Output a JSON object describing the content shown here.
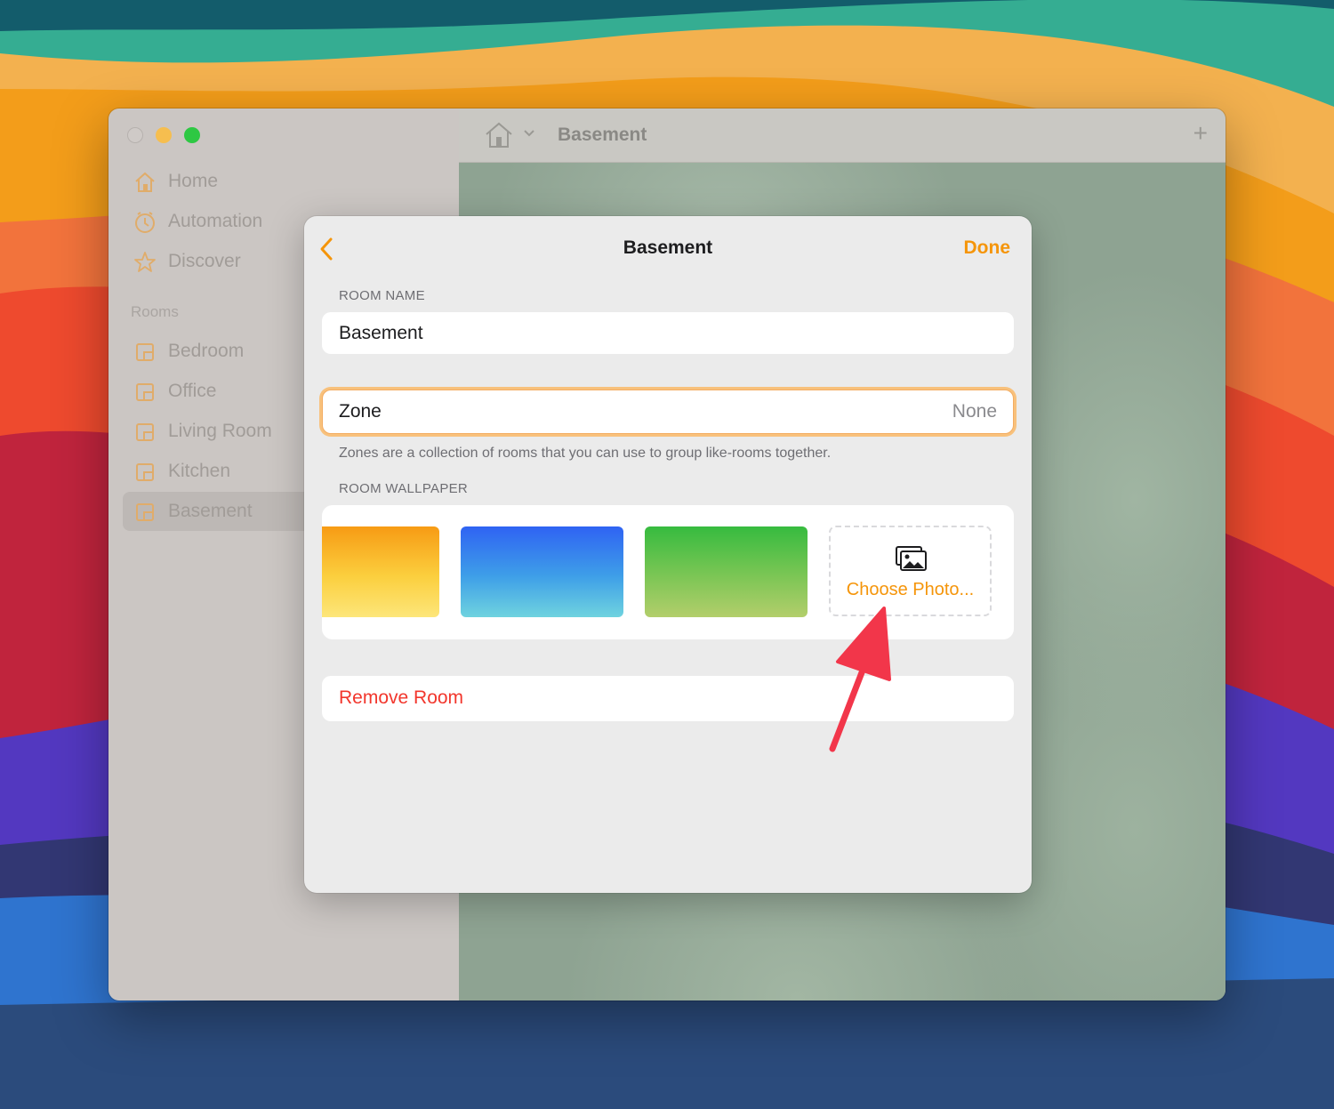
{
  "window": {
    "toolbar_title": "Basement"
  },
  "sidebar": {
    "nav": [
      {
        "label": "Home",
        "icon": "house-icon"
      },
      {
        "label": "Automation",
        "icon": "clock-icon"
      },
      {
        "label": "Discover",
        "icon": "star-icon"
      }
    ],
    "rooms_header": "Rooms",
    "rooms": [
      {
        "label": "Bedroom",
        "icon": "room-icon"
      },
      {
        "label": "Office",
        "icon": "room-icon"
      },
      {
        "label": "Living Room",
        "icon": "room-icon"
      },
      {
        "label": "Kitchen",
        "icon": "room-icon"
      },
      {
        "label": "Basement",
        "icon": "room-icon",
        "selected": true
      }
    ]
  },
  "sheet": {
    "title": "Basement",
    "done_label": "Done",
    "room_name_label": "ROOM NAME",
    "room_name_value": "Basement",
    "zone_label": "Zone",
    "zone_value": "None",
    "zone_helper": "Zones are a collection of rooms that you can use to group like-rooms together.",
    "wallpaper_label": "ROOM WALLPAPER",
    "wallpapers": [
      "orange-yellow-gradient",
      "blue-cyan-gradient",
      "green-lime-gradient"
    ],
    "choose_photo_label": "Choose Photo...",
    "remove_label": "Remove Room"
  },
  "colors": {
    "accent": "#f5950a",
    "destructive": "#f2362c",
    "annotation_arrow": "#f2364a"
  }
}
